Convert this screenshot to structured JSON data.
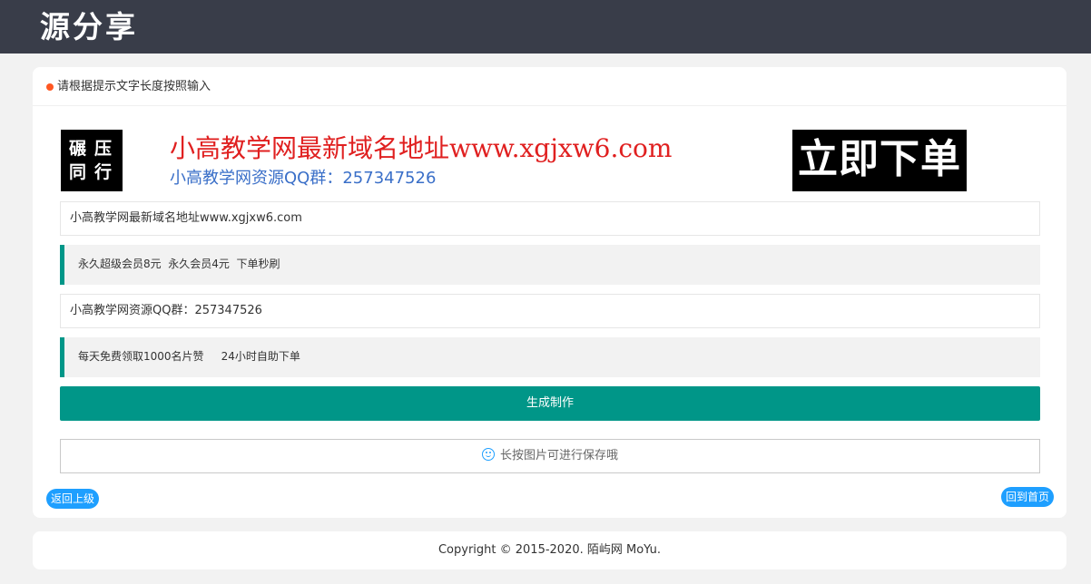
{
  "header": {
    "logo_text": "源分享"
  },
  "card": {
    "hint": "请根据提示文字长度按照输入",
    "preview": {
      "stamp_line1": "碾压",
      "stamp_line2": "同行",
      "line1": "小高教学网最新域名地址www.xgjxw6.com",
      "line2": "小高教学网资源QQ群：257347526",
      "order_button": "立即下单"
    },
    "input1": {
      "value": "小高教学网最新域名地址www.xgjxw6.com"
    },
    "tip1": "永久超级会员8元  永久会员4元  下单秒刷",
    "input2": {
      "value": "小高教学网资源QQ群：257347526"
    },
    "tip2": "每天免费领取1000名片赞     24小时自助下单",
    "generate_button": "生成制作",
    "save_hint": "长按图片可进行保存哦",
    "back_link": "返回上级",
    "home_link": "回到首页"
  },
  "footer": {
    "copyright": "Copyright © 2015-2020. 陌屿网 MoYu."
  },
  "colors": {
    "topbar": "#393d49",
    "accent": "#009688",
    "blue": "#1e9fff",
    "dot": "#ff5722",
    "headline_red": "#e02020"
  }
}
